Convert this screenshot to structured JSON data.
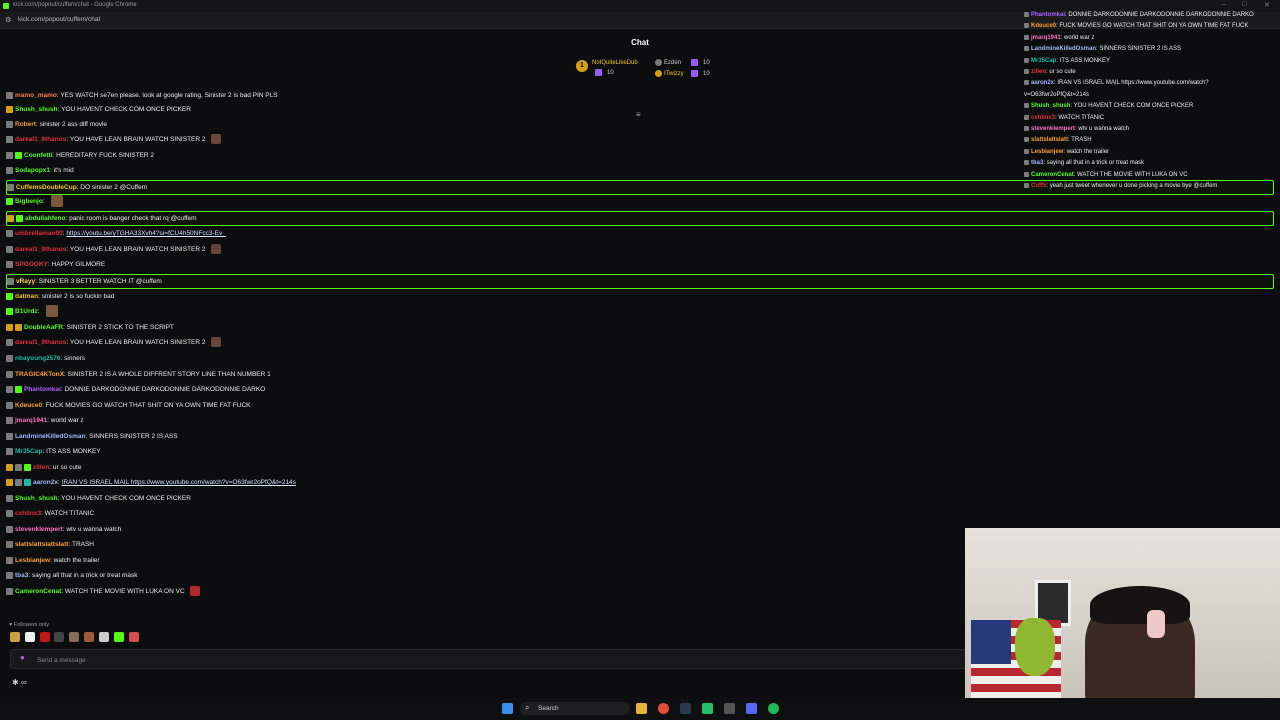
{
  "browser": {
    "window_title": "kick.com/popout/cuffem/chat - Google Chrome",
    "url": "kick.com/popout/cuffem/chat"
  },
  "header": {
    "title": "Chat",
    "gifters": [
      {
        "rank": "1",
        "name": "NotQuiteLikeDub",
        "count": "10"
      },
      {
        "name": "Ezden",
        "count": "10"
      },
      {
        "name": "ITwizzy",
        "count": "10"
      }
    ]
  },
  "messages": [
    {
      "user": "mamo_mamo",
      "color": "#ff7a45",
      "text": "YES WATCH se7en please. look at google rating. Sinister 2 is bad PIN PLS"
    },
    {
      "user": "Shush_shush",
      "color": "#53fc18",
      "text": "YOU HAVENT CHECK COM ONCE PICKER"
    },
    {
      "user": "Robert",
      "color": "#ff9d2e",
      "text": "sinister 2 ass diff movie"
    },
    {
      "user": "dareal1_9thanos",
      "color": "#e0323b",
      "text": "YOU HAVE LEAN BRAIN WATCH SINISTER 2"
    },
    {
      "user": "Coonfetti",
      "color": "#53fc18",
      "text": "HEREDITARY FUCK SINISTER 2"
    },
    {
      "user": "Sodapopx1",
      "color": "#53fc18",
      "text": "it's mid"
    },
    {
      "user": "CuffemsDoubleCup",
      "color": "#f5c518",
      "text": "DO sinister 2 @Cuffem"
    },
    {
      "user": "Bigbenjo",
      "color": "#53fc18",
      "text": ""
    },
    {
      "user": "abdullahfeno",
      "color": "#53fc18",
      "text": "panic room is banger check that rq @cuffem"
    },
    {
      "user": "umbrellaman00",
      "color": "#e0323b",
      "text": "https://youtu.be/yTGHA33Xvh4?si=fCU4h50NFcc3-Ev_"
    },
    {
      "user": "dareal1_9thanos",
      "color": "#e0323b",
      "text": "YOU HAVE LEAN BRAIN WATCH SINISTER 2"
    },
    {
      "user": "SPOOOKY",
      "color": "#e0323b",
      "text": "HAPPY GILMORE"
    },
    {
      "user": "vRayy",
      "color": "#ffd84a",
      "text": "SINISTER 3 BETTER WATCH IT @cuffem"
    },
    {
      "user": "datman",
      "color": "#f5c518",
      "text": "sinister 2 is so fuckin bad"
    },
    {
      "user": "B1Urdz",
      "color": "#53fc18",
      "text": ""
    },
    {
      "user": "DoubleAaFR",
      "color": "#53fc18",
      "text": "SINISTER 2 STICK TO THE SCRIPT"
    },
    {
      "user": "dareal1_9thanos",
      "color": "#e0323b",
      "text": "YOU HAVE LEAN BRAIN WATCH SINISTER 2"
    },
    {
      "user": "nbayoung2576",
      "color": "#1fb8a8",
      "text": "sinners"
    },
    {
      "user": "TRAGIC4KTonX",
      "color": "#ff9d2e",
      "text": "SINISTER 2 IS A WHOLE DIFFRENT STORY LINE THAN NUMBER 1"
    },
    {
      "user": "Phantomkai",
      "color": "#b060ff",
      "text": "DONNIE DARKODONNIE DARKODONNIE DARKODONNIE DARKO"
    },
    {
      "user": "Kdeuce0",
      "color": "#ff9d2e",
      "text": "FUCK MOVIES GO WATCH THAT SHIT ON YA OWN TIME FAT FUCK"
    },
    {
      "user": "jmarq1941",
      "color": "#ff6ec7",
      "text": "world war z"
    },
    {
      "user": "LandmineKilledOsman",
      "color": "#9fb7ff",
      "text": "SINNERS SINISTER 2 IS ASS"
    },
    {
      "user": "Mr35Cap",
      "color": "#1fb8a8",
      "text": "ITS ASS MONKEY"
    },
    {
      "user": "zillen",
      "color": "#e0323b",
      "text": "ur so cute"
    },
    {
      "user": "aaron2x",
      "color": "#9fb7ff",
      "text": "IRAN VS ISRAEL MAIL https://www.youtube.com/watch?v=O63fwr2oPfQ&t=214s"
    },
    {
      "user": "Shush_shush",
      "color": "#53fc18",
      "text": "YOU HAVENT CHECK COM ONCE PICKER"
    },
    {
      "user": "cxhlinx3",
      "color": "#e0323b",
      "text": "WATCH TITANIC"
    },
    {
      "user": "stevenklempert",
      "color": "#ff6ec7",
      "text": "wtv u wanna watch"
    },
    {
      "user": "slattslattslattslatt",
      "color": "#ff9d2e",
      "text": "TRASH"
    },
    {
      "user": "Lesbianjew",
      "color": "#ff9d2e",
      "text": "watch the trailer"
    },
    {
      "user": "tba3",
      "color": "#9fb7ff",
      "text": "saying all that in a trick or treat mask"
    },
    {
      "user": "CameronCenat",
      "color": "#53fc18",
      "text": "WATCH THE MOVIE WITH LUKA ON VC"
    }
  ],
  "overlay": [
    {
      "user": "Phantomkai",
      "color": "#b060ff",
      "text": "DONNIE DARKODONNIE DARKODONNIE DARKODONNIE DARKO"
    },
    {
      "user": "Kdeuce0",
      "color": "#ff9d2e",
      "text": "FUCK MOVIES GO WATCH THAT SHIT ON YA OWN TIME FAT FUCK"
    },
    {
      "user": "jmarq1941",
      "color": "#ff6ec7",
      "text": "world war z"
    },
    {
      "user": "LandmineKilledOsman",
      "color": "#9fb7ff",
      "text": "SINNERS SINISTER 2 IS ASS"
    },
    {
      "user": "Mr35Cap",
      "color": "#1fb8a8",
      "text": "ITS ASS MONKEY"
    },
    {
      "user": "zillen",
      "color": "#e0323b",
      "text": "ur so cute"
    },
    {
      "user": "aaron2x",
      "color": "#9fb7ff",
      "text": "IRAN VS ISRAEL MAIL https://www.youtube.com/watch?"
    },
    {
      "user": "",
      "color": "#9fb7ff",
      "text": "v=O63fwr2oPfQ&t=214s"
    },
    {
      "user": "Shush_shush",
      "color": "#53fc18",
      "text": "YOU HAVENT CHECK COM ONCE PICKER"
    },
    {
      "user": "cxhlinx3",
      "color": "#e0323b",
      "text": "WATCH TITANIC"
    },
    {
      "user": "stevenklempert",
      "color": "#ff6ec7",
      "text": "wtv u wanna watch"
    },
    {
      "user": "slattslattslatt",
      "color": "#ff9d2e",
      "text": "TRASH"
    },
    {
      "user": "Lesbianjew",
      "color": "#ff9d2e",
      "text": "watch the trailer"
    },
    {
      "user": "tba3",
      "color": "#9fb7ff",
      "text": "saying all that in a trick or treat mask"
    },
    {
      "user": "CameronCenat",
      "color": "#53fc18",
      "text": "WATCH THE MOVIE WITH LUKA ON VC"
    },
    {
      "user": "Cuff5",
      "color": "#e0323b",
      "text": "yeah just tweet whenever u done picking a movie bye @cuffem"
    }
  ],
  "footer": {
    "followers_only": "Followers only",
    "send_placeholder": "Send a message",
    "tools_icon": "∞"
  },
  "taskbar": {
    "search_label": "Search"
  },
  "colors": {
    "accent": "#53fc18",
    "background": "#0b0d0e"
  }
}
